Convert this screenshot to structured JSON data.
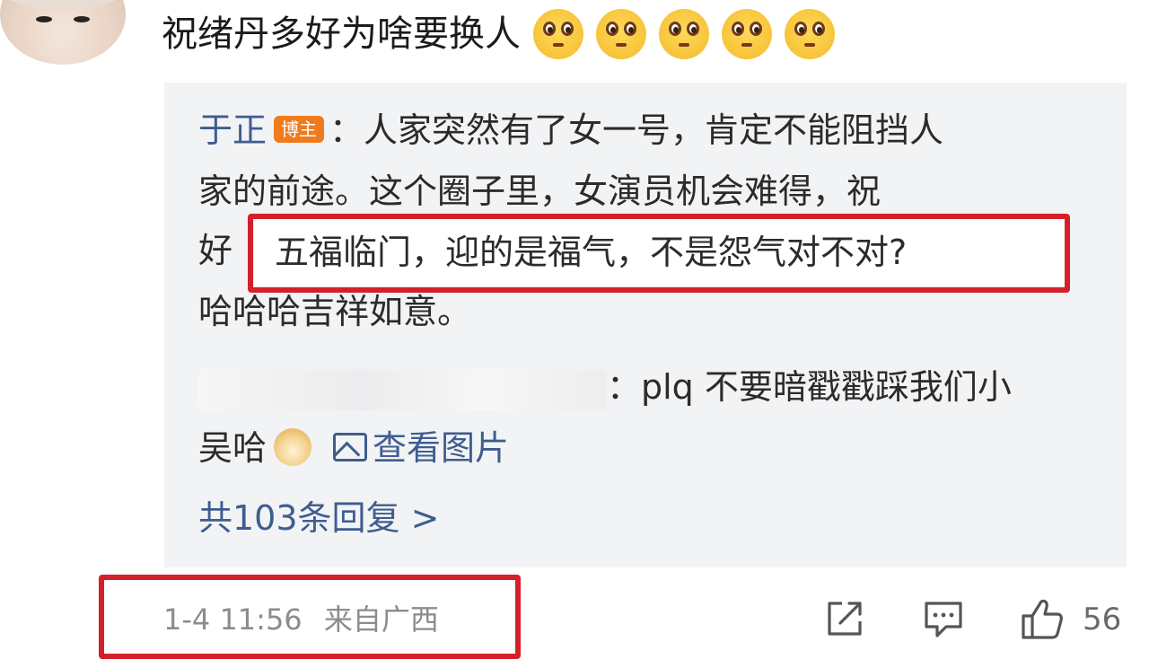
{
  "comment": {
    "text": "祝绪丹多好为啥要换人",
    "emoji_icon": "pleading-face-emoji",
    "emoji_count": 5
  },
  "reply": {
    "author": "于正",
    "badge": "博主",
    "line1": "：人家突然有了女一号，肯定不能阻挡人",
    "line2": "家的前途。这个圈子里，女演员机会难得，祝",
    "line3_prefix": "好",
    "line3_highlight": "五福临门，迎的是福气，不是怨气对不对?",
    "line4": "哈哈哈吉祥如意。",
    "sub_reply_text": "：plq 不要暗戳戳踩我们小",
    "sub_reply_line2": "吴哈",
    "sub_reply_emoji": "doge-emoji",
    "view_image_label": "查看图片",
    "total_replies": "共103条回复 >"
  },
  "footer": {
    "timestamp": "1-4 11:56",
    "location": "来自广西",
    "like_count": "56"
  },
  "colors": {
    "link_blue": "#3e5d8f",
    "badge_orange": "#f07b1c",
    "highlight_red": "#d4202a",
    "reply_bg": "#f2f3f5"
  }
}
